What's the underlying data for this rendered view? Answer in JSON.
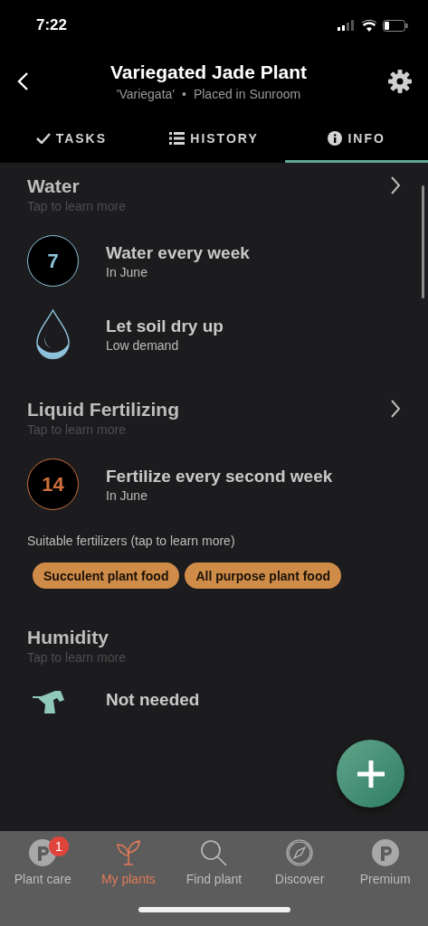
{
  "status_bar": {
    "time": "7:22"
  },
  "header": {
    "title": "Variegated Jade Plant",
    "cultivar": "'Variegata'",
    "separator": "•",
    "location": "Placed in Sunroom"
  },
  "tabs": [
    {
      "label": "TASKS",
      "kind": "check",
      "selected": false
    },
    {
      "label": "HISTORY",
      "kind": "list",
      "selected": false
    },
    {
      "label": "INFO",
      "kind": "info",
      "selected": true
    }
  ],
  "sections": [
    {
      "title": "Water",
      "subtitle": "Tap to learn more",
      "items": [
        {
          "kind": "count",
          "value": "7",
          "color": "#8ec3dc",
          "title": "Water every week",
          "detail": "In June"
        },
        {
          "kind": "drop",
          "title": "Let soil dry up",
          "detail": "Low demand"
        }
      ]
    },
    {
      "title": "Liquid Fertilizing",
      "subtitle": "Tap to learn more",
      "items": [
        {
          "kind": "count",
          "value": "14",
          "color": "#d0703c",
          "title": "Fertilize every second week",
          "detail": "In June"
        }
      ],
      "note": "Suitable fertilizers (tap to learn more)",
      "chips": [
        "Succulent plant food",
        "All purpose plant food"
      ]
    },
    {
      "title": "Humidity",
      "subtitle": "Tap to learn more",
      "items": [
        {
          "kind": "sprayer",
          "title": "Not needed"
        }
      ]
    }
  ],
  "nav": [
    {
      "label": "Plant care",
      "kind": "logo",
      "badge": "1",
      "selected": false
    },
    {
      "label": "My plants",
      "kind": "sprout",
      "selected": true
    },
    {
      "label": "Find plant",
      "kind": "search",
      "selected": false
    },
    {
      "label": "Discover",
      "kind": "compass",
      "selected": false
    },
    {
      "label": "Premium",
      "kind": "logo",
      "selected": false
    }
  ]
}
